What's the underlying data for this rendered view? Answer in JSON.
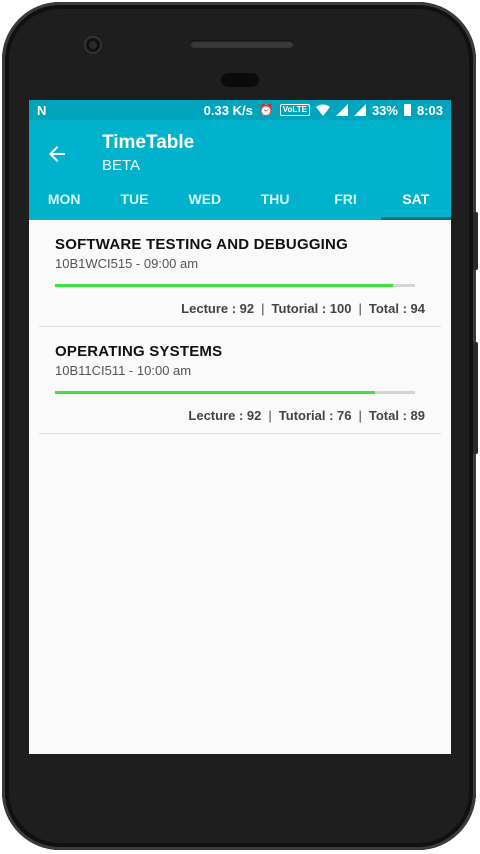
{
  "status_bar": {
    "network_speed": "0.33 K/s",
    "volte": "VoLTE",
    "battery": "33%",
    "time": "8:03",
    "left_logo": "N"
  },
  "app_bar": {
    "title": "TimeTable",
    "subtitle": "BETA",
    "color": "#00b2cc"
  },
  "tabs": [
    {
      "label": "MON",
      "active": false
    },
    {
      "label": "TUE",
      "active": false
    },
    {
      "label": "WED",
      "active": false
    },
    {
      "label": "THU",
      "active": false
    },
    {
      "label": "FRI",
      "active": false
    },
    {
      "label": "SAT",
      "active": true
    }
  ],
  "courses": [
    {
      "name": "SOFTWARE TESTING AND DEBUGGING",
      "code_time": "10B1WCI515 - 09:00 am",
      "progress_percent": 94,
      "lecture": "Lecture : 92",
      "tutorial": "Tutorial : 100",
      "total": "Total : 94"
    },
    {
      "name": "OPERATING SYSTEMS",
      "code_time": "10B11CI511 - 10:00 am",
      "progress_percent": 89,
      "lecture": "Lecture : 92",
      "tutorial": "Tutorial : 76",
      "total": "Total : 89"
    }
  ],
  "separator": "|"
}
